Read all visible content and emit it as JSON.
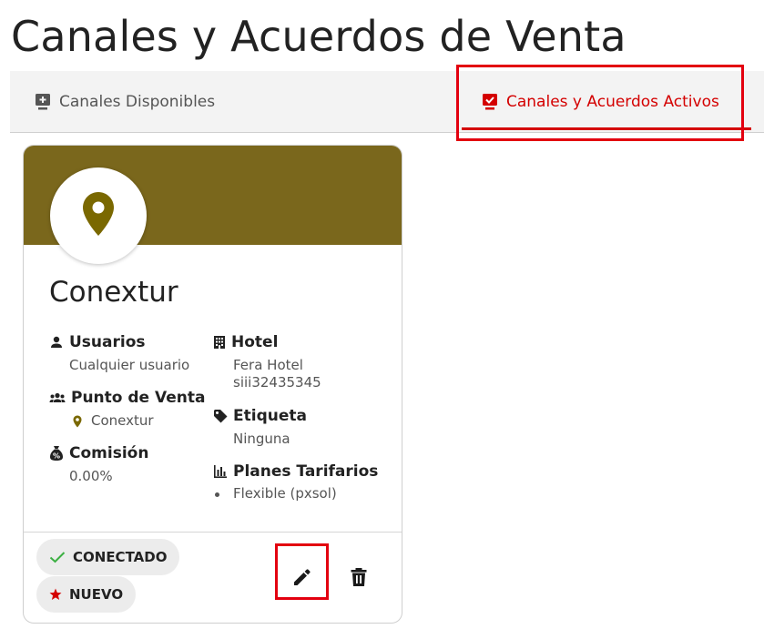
{
  "page": {
    "title": "Canales y Acuerdos de Venta"
  },
  "tabs": [
    {
      "label": "Canales Disponibles",
      "icon": "add-to-queue-icon",
      "active": false
    },
    {
      "label": "Canales y Acuerdos Activos",
      "icon": "check-monitor-icon",
      "active": true
    }
  ],
  "colors": {
    "accent": "#d40000",
    "banner": "#7a671c",
    "highlight": "#e3000f",
    "pin": "#7a6800",
    "check": "#3cb043"
  },
  "card": {
    "name": "Conextur",
    "avatar_icon": "map-pin-icon",
    "fields": {
      "users": {
        "label": "Usuarios",
        "value": "Cualquier usuario"
      },
      "pos": {
        "label": "Punto de Venta",
        "value": "Conextur"
      },
      "commission": {
        "label": "Comisión",
        "value": "0.00%"
      },
      "hotel": {
        "label": "Hotel",
        "line1": "Fera Hotel",
        "line2": "siii32435345"
      },
      "tag": {
        "label": "Etiqueta",
        "value": "Ninguna"
      },
      "rate_plans": {
        "label": "Planes Tarifarios",
        "items": [
          "Flexible (pxsol)"
        ]
      }
    },
    "status": {
      "connected": "CONECTADO",
      "new": "NUEVO"
    }
  }
}
